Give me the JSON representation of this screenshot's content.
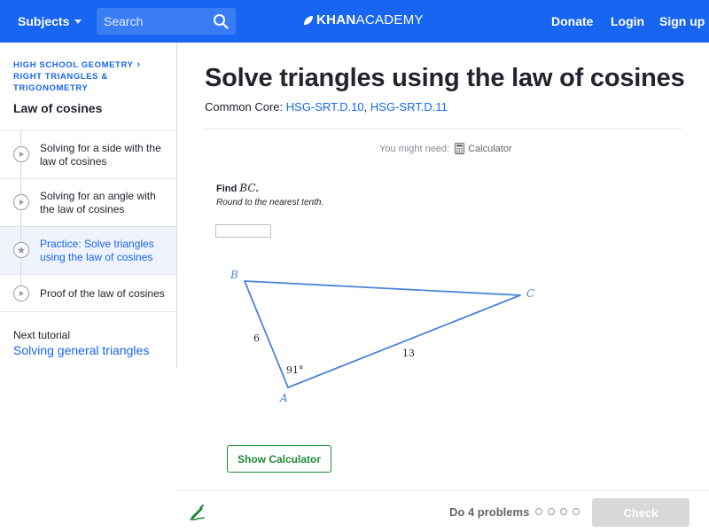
{
  "header": {
    "subjects_label": "Subjects",
    "search_placeholder": "Search",
    "logo_bold": "KHAN",
    "logo_light": "ACADEMY",
    "donate": "Donate",
    "login": "Login",
    "signup": "Sign up",
    "brand_color": "#1865f2"
  },
  "sidebar": {
    "crumb_line1": "HIGH SCHOOL GEOMETRY",
    "crumb_line2": "RIGHT TRIANGLES &",
    "crumb_line3": "TRIGONOMETRY",
    "tutorial_title": "Law of cosines",
    "items": [
      {
        "label": "Solving for a side with the law of cosines",
        "icon": "play-icon"
      },
      {
        "label": "Solving for an angle with the law of cosines",
        "icon": "play-icon"
      },
      {
        "label": "Practice: Solve triangles using the law of cosines",
        "icon": "star-icon",
        "active": true
      },
      {
        "label": "Proof of the law of cosines",
        "icon": "play-icon"
      }
    ],
    "next_label": "Next tutorial",
    "next_link": "Solving general triangles"
  },
  "main": {
    "title": "Solve triangles using the law of cosines",
    "common_core_label": "Common Core:",
    "standard_1": "HSG-SRT.D.10",
    "separator": ",",
    "standard_2": "HSG-SRT.D.11",
    "might_need": "You might need:",
    "calculator_link": "Calculator",
    "find_prefix": "Find",
    "find_var": "BC",
    "find_suffix": ".",
    "round_text": "Round to the nearest tenth.",
    "answer_value": "",
    "diagram": {
      "vertex_a": "A",
      "vertex_b": "B",
      "vertex_c": "C",
      "side_ab": "6",
      "side_ac": "13",
      "angle_a": "91°",
      "stroke_color": "#4c84d6"
    },
    "show_calculator": "Show Calculator"
  },
  "footer": {
    "do_problems": "Do 4 problems",
    "check": "Check",
    "progress_total": 4,
    "progress_done": 0
  }
}
